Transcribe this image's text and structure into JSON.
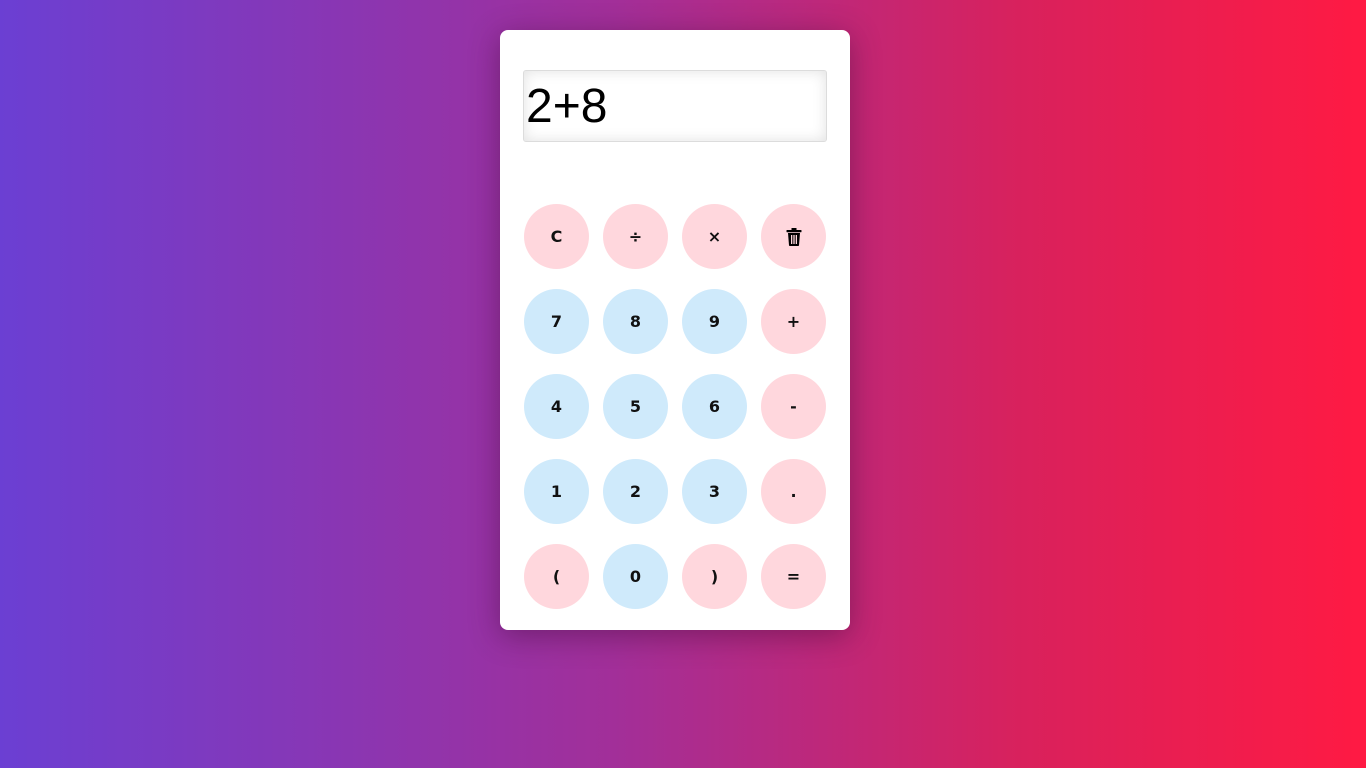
{
  "colors": {
    "operator_key_bg": "#ffd7dd",
    "number_key_bg": "#cfeafb",
    "panel_bg": "#ffffff"
  },
  "display": {
    "value": "2+8"
  },
  "keys": {
    "clear": "C",
    "divide": "÷",
    "multiply": "×",
    "delete_icon": "trash-icon",
    "seven": "7",
    "eight": "8",
    "nine": "9",
    "plus": "+",
    "four": "4",
    "five": "5",
    "six": "6",
    "minus": "-",
    "one": "1",
    "two": "2",
    "three": "3",
    "decimal": ".",
    "open_paren": "(",
    "zero": "0",
    "close_paren": ")",
    "equals": "="
  }
}
